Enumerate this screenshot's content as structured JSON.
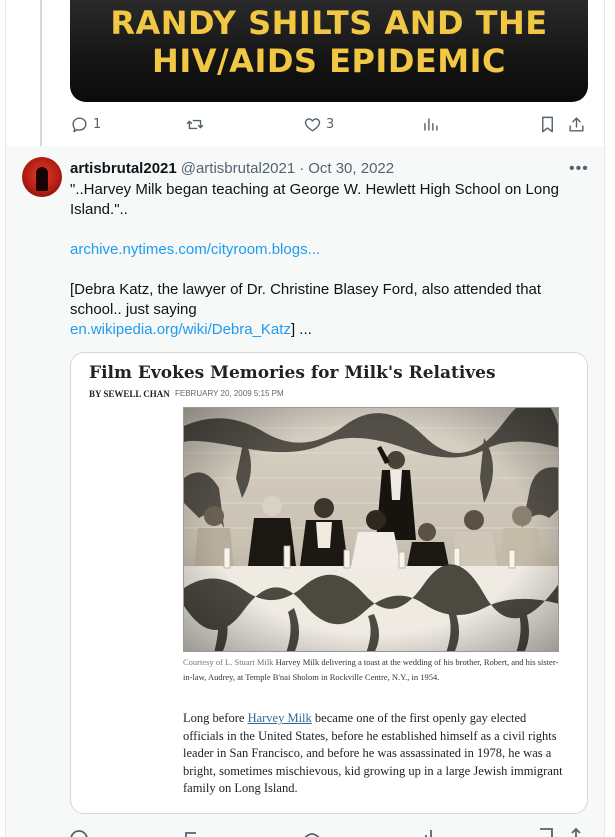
{
  "prev_tweet": {
    "banner_line1": "RANDY SHILTS AND THE",
    "banner_line2": "HIV/AIDS EPIDEMIC",
    "actions": {
      "reply_count": "1",
      "retweet_count": "",
      "like_count": "3",
      "views_count": ""
    }
  },
  "tweet": {
    "display_name": "artisbrutal2021",
    "handle": "@artisbrutal2021",
    "separator": "·",
    "date": "Oct 30, 2022",
    "more_label": "•••",
    "line1": "\"..Harvey Milk began teaching at George W. Hewlett High School on Long",
    "line2": "Island.\"..",
    "link1": "archive.nytimes.com/cityroom.blogs...",
    "line3": "[Debra Katz, the lawyer of Dr. Christine Blasey Ford, also attended that",
    "line4": "school.. just saying",
    "link2": "en.wikipedia.org/wiki/Debra_Katz",
    "line5_tail": "] ..."
  },
  "card": {
    "headline": "Film Evokes Memories for Milk's Relatives",
    "byline": "BY SEWELL CHAN",
    "dateline": "FEBRUARY 20, 2009 5:15 PM",
    "caption_credit": "Courtesy of L. Stuart Milk",
    "caption_text": " Harvey Milk delivering a toast at the wedding of his brother, Robert, and his sister-in-law, Audrey, at Temple B'nai Sholom in Rockville Centre, N.Y., in 1954.",
    "body_prefix": "Long before ",
    "body_link": "Harvey Milk",
    "body_rest": " became one of the first openly gay elected officials in the United States, before he established himself as a civil rights leader in San Francisco, and before he was assassinated in 1978, he was a bright, sometimes mischievous, kid growing up in a large Jewish immigrant family on Long Island."
  },
  "colors": {
    "link": "#1d9bf0",
    "muted": "#536471",
    "banner_text": "#f2c744"
  },
  "icons": [
    "reply-icon",
    "retweet-icon",
    "like-icon",
    "views-icon",
    "bookmark-icon",
    "share-icon",
    "more-icon"
  ]
}
